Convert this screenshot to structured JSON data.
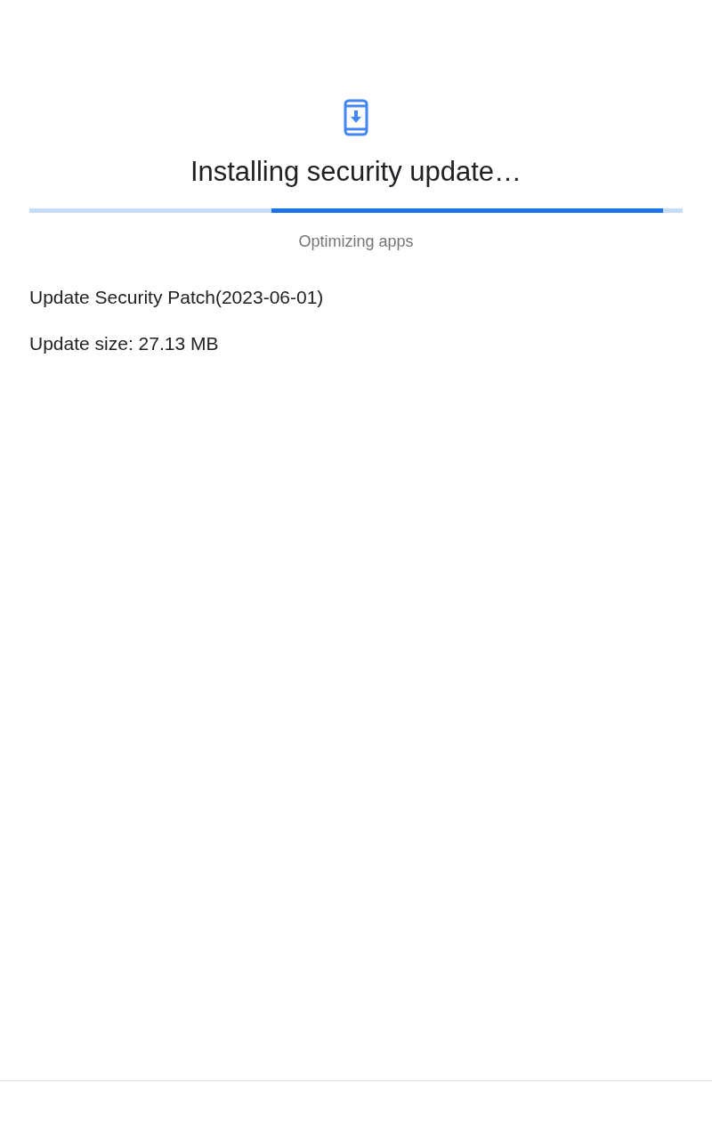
{
  "title": "Installing security update…",
  "progress": {
    "indeterminate": true
  },
  "status": "Optimizing apps",
  "details": [
    "Update Security Patch(2023-06-01)",
    "Update size: 27.13 MB"
  ]
}
